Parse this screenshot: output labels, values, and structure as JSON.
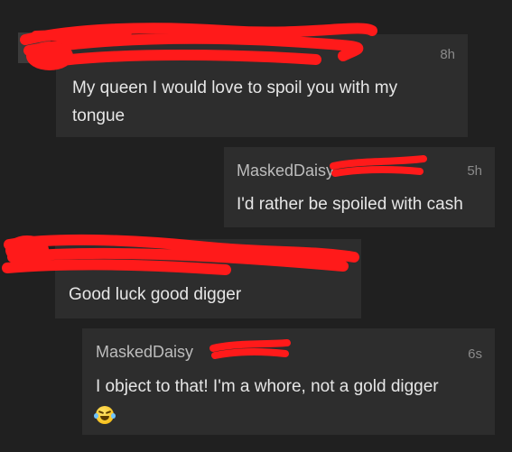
{
  "comments": [
    {
      "author": "",
      "time": "8h",
      "text": "My queen I would love to spoil you with my tongue"
    },
    {
      "author": "MaskedDaisy",
      "time": "5h",
      "text": "I'd rather be spoiled with cash"
    },
    {
      "author": "",
      "time": "",
      "text": "Good luck good digger"
    },
    {
      "author": "MaskedDaisy",
      "time": "6s",
      "text": "I object to that! I'm a whore, not a gold digger",
      "emoji": "rolling-on-floor-laughing-emoji"
    }
  ],
  "colors": {
    "background": "#202020",
    "bubble": "#2d2d2d",
    "redaction": "#ff1a1a",
    "text": "#e6e6e6",
    "name": "#bdbdbd",
    "time": "#8a8a8a"
  }
}
